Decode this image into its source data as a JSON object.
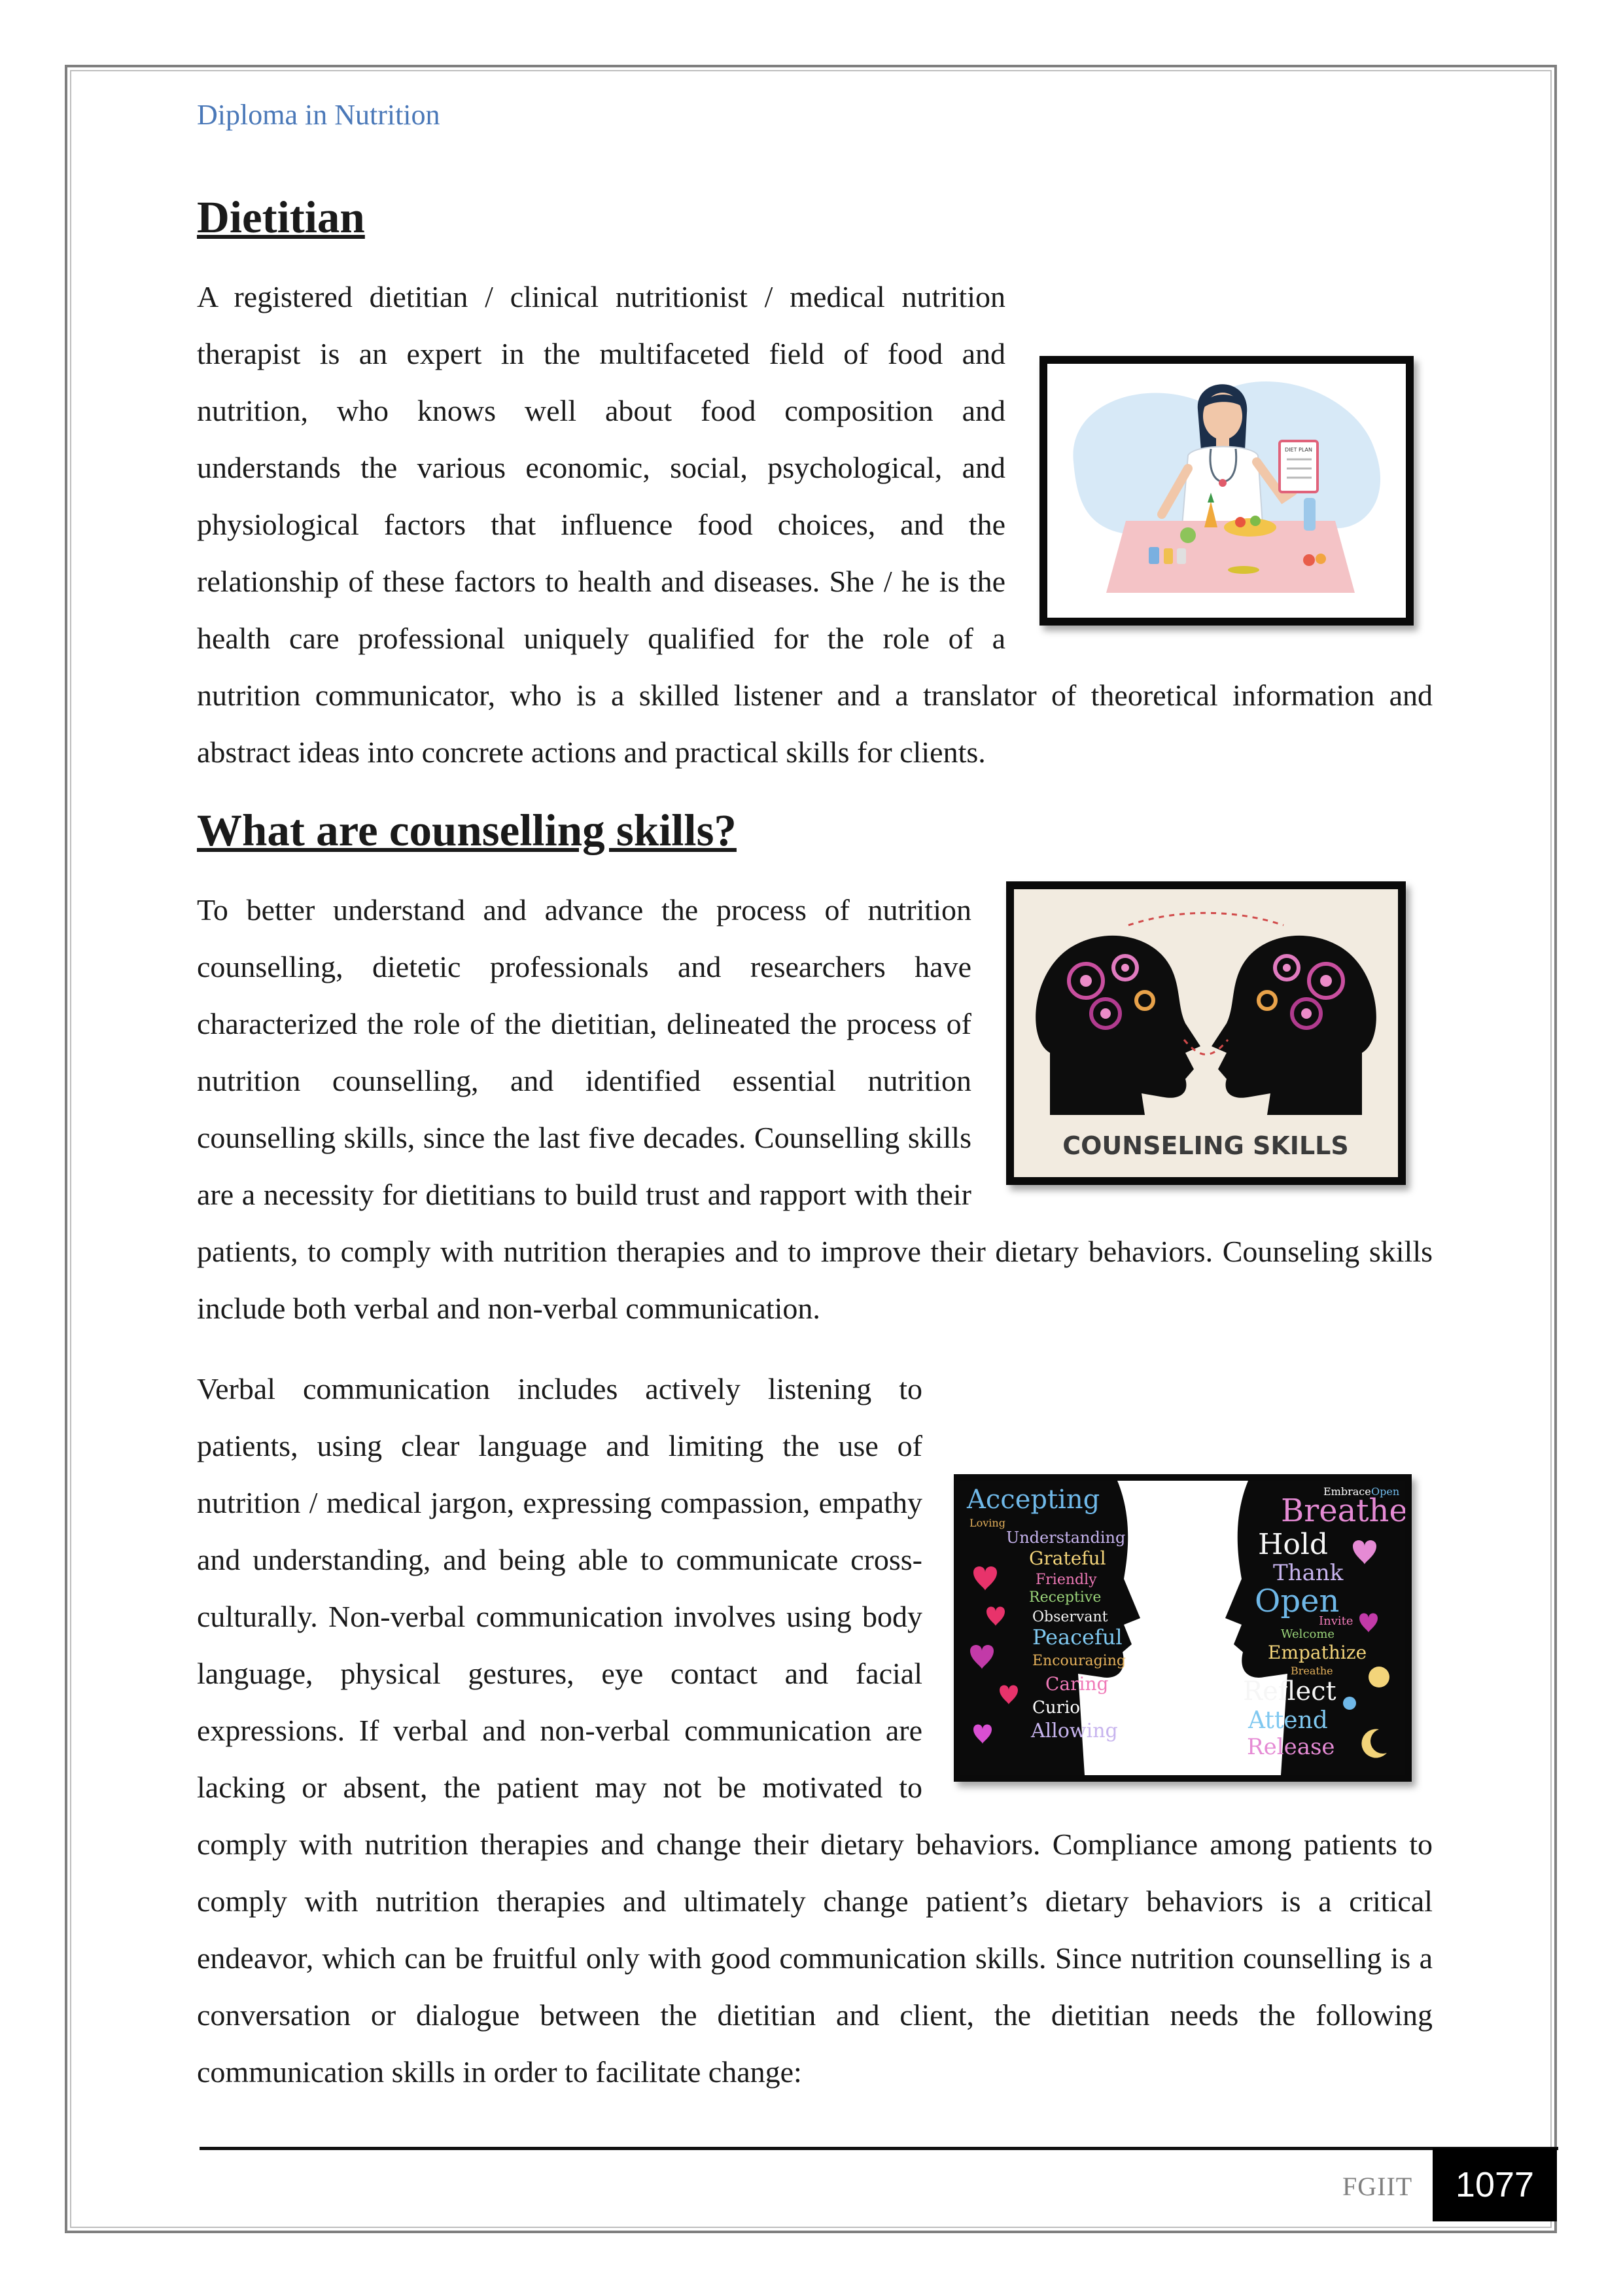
{
  "header": {
    "running_title": "Diploma in Nutrition"
  },
  "sections": {
    "dietitian": {
      "heading": "Dietitian",
      "paragraph": "A registered dietitian / clinical nutritionist / medical nutrition therapist is an expert in the multifaceted field of food and nutrition, who knows well about food composition and understands the various economic, social, psychological, and physiological factors that influence food choices, and the relationship of these factors to health and diseases. She / he is the health care professional uniquely qualified for the role of a nutrition communicator, who is a skilled listener and a translator of theoretical information and abstract ideas into concrete actions and practical skills for clients."
    },
    "counselling": {
      "heading": "What are counselling skills?",
      "paragraph1": "To better understand and advance the process of nutrition counselling, dietetic professionals and researchers have characterized the role of the dietitian, delineated the process of nutrition counselling, and identified essential nutrition counselling skills, since the last five decades. Counselling skills are a necessity for dietitians to build trust and rapport with their patients, to comply with nutrition therapies and to improve their dietary behaviors. Counseling skills include both verbal and non-verbal communication.",
      "paragraph2": "Verbal communication includes actively listening to patients, using clear language and limiting the use of nutrition / medical jargon, expressing compassion, empathy and understanding, and being able to communicate cross-culturally. Non-verbal communication involves using body language, physical gestures, eye contact and facial expressions. If verbal and non-verbal communication are lacking or absent, the patient may not be motivated to comply with nutrition therapies and change their dietary behaviors. Compliance among patients to comply with nutrition therapies and ultimately change patient’s dietary behaviors is a critical endeavor, which can be fruitful only with good communication skills. Since nutrition counselling is a conversation or dialogue between the dietitian and client, the dietitian needs the following communication skills in order to facilitate change:"
    }
  },
  "figures": {
    "dietitian_illustration": {
      "icon": "dietitian-illustration",
      "clipboard_text": "DIET PLAN"
    },
    "counseling_skills": {
      "icon": "two-heads-gears-illustration",
      "caption": "COUNSELING SKILLS"
    },
    "word_cloud": {
      "icon": "face-silhouettes-word-cloud",
      "left_words": [
        "Accepting",
        "Loving",
        "Understanding",
        "Grateful",
        "Friendly",
        "Receptive",
        "Observant",
        "Peaceful",
        "Encouraging",
        "Caring",
        "Curious",
        "Allowing"
      ],
      "right_words": [
        "Embrace",
        "Open",
        "Breathe",
        "Hold",
        "Thank",
        "Open",
        "Invite",
        "Welcome",
        "Empathize",
        "Breathe",
        "Reflect",
        "Attend",
        "Release"
      ]
    }
  },
  "footer": {
    "label": "FGIIT",
    "page_number": "1077"
  }
}
